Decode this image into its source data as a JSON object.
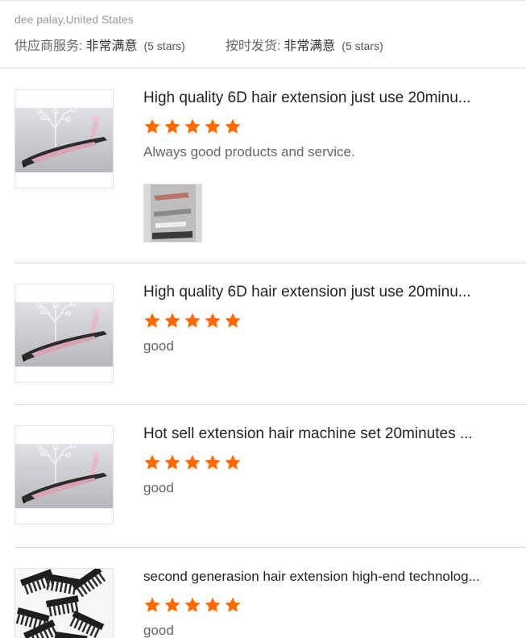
{
  "reviewer": "dee palay,United States",
  "seller_ratings": [
    {
      "label": "供应商服务:",
      "value": "非常满意",
      "stars": "(5 stars)"
    },
    {
      "label": "按时发货:",
      "value": "非常满意",
      "stars": "(5 stars)"
    }
  ],
  "reviews": [
    {
      "title": "High quality 6D hair extension just use 20minu...",
      "rating": 5,
      "comment": "Always good products and service.",
      "thumb_icon": "hair-extension-tool-image",
      "has_attachment": true
    },
    {
      "title": "High quality 6D hair extension just use 20minu...",
      "rating": 5,
      "comment": "good",
      "thumb_icon": "hair-extension-tool-image",
      "has_attachment": false
    },
    {
      "title": "Hot sell extension hair machine set 20minutes ...",
      "rating": 5,
      "comment": "good",
      "thumb_icon": "hair-extension-tool-image",
      "has_attachment": false
    },
    {
      "title": "second generasion hair extension high-end technolog...",
      "rating": 5,
      "comment": "good",
      "thumb_icon": "hair-clips-pile-image",
      "has_attachment": false
    }
  ],
  "colors": {
    "star": "#ff6a00",
    "divider": "#d6d6d6",
    "muted_text": "#9a9a9a"
  }
}
